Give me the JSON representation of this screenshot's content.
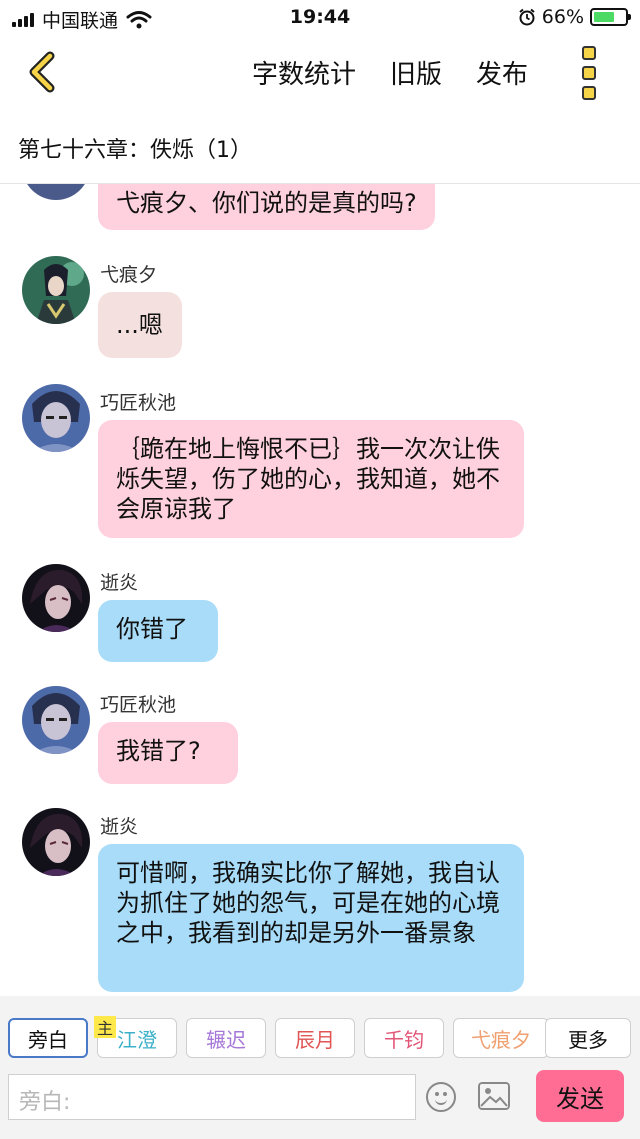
{
  "status_bar": {
    "carrier": "中国联通",
    "time": "19:44",
    "battery": "66%"
  },
  "nav": {
    "word_count": "字数统计",
    "old_version": "旧版",
    "publish": "发布"
  },
  "chapter": {
    "title": "第七十六章：佚烁（1）"
  },
  "messages": [
    {
      "sender": "",
      "text": "弋痕夕、你们说的是真的吗?"
    },
    {
      "sender": "弋痕夕",
      "text": "...嗯"
    },
    {
      "sender": "巧匠秋池",
      "text": "｛跪在地上悔恨不已｝我一次次让佚烁失望，伤了她的心，我知道，她不会原谅我了"
    },
    {
      "sender": "逝炎",
      "text": "你错了"
    },
    {
      "sender": "巧匠秋池",
      "text": "我错了?"
    },
    {
      "sender": "逝炎",
      "text": "可惜啊，我确实比你了解她，我自认为抓住了她的怨气，可是在她的心境之中，我看到的却是另外一番景象"
    }
  ],
  "roles": [
    {
      "label": "旁白",
      "color": "#111111"
    },
    {
      "label": "江澄",
      "color": "#3bb0c9"
    },
    {
      "label": "辗迟",
      "color": "#a678d8"
    },
    {
      "label": "辰月",
      "color": "#e05555"
    },
    {
      "label": "千钧",
      "color": "#e25577"
    },
    {
      "label": "弋痕夕",
      "color": "#f0a070"
    },
    {
      "label": "更多",
      "color": "#111111"
    }
  ],
  "main_badge": "主",
  "input": {
    "placeholder": "旁白:"
  },
  "send_label": "发送"
}
